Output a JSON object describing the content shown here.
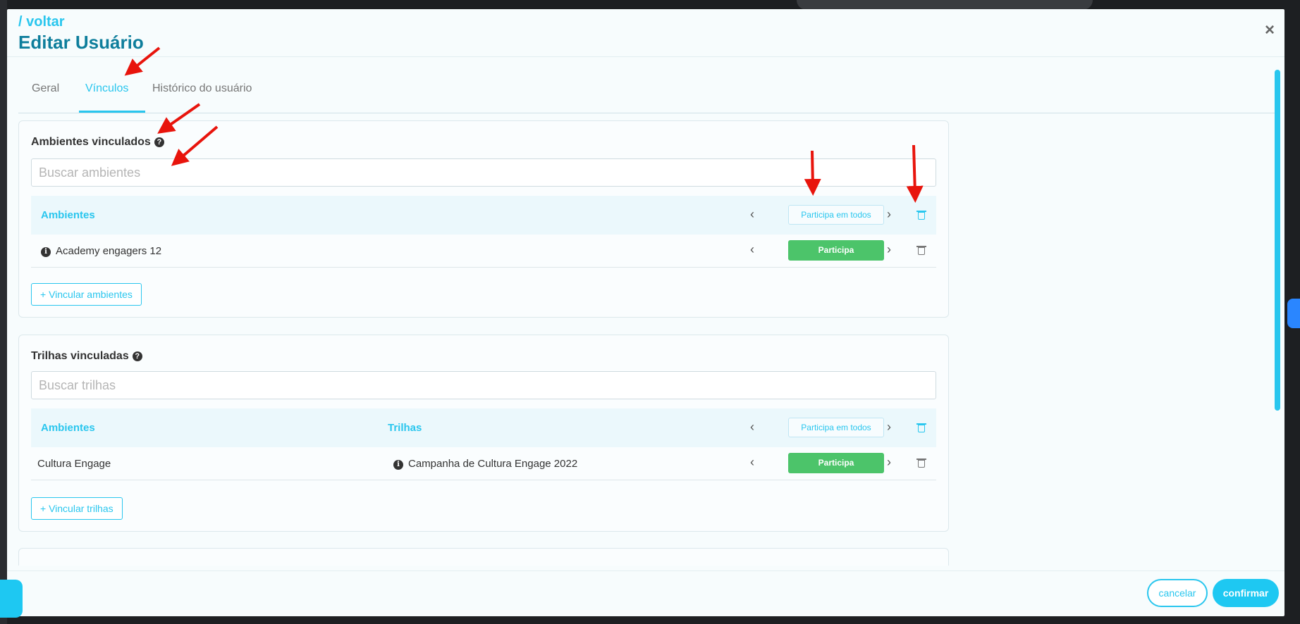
{
  "header": {
    "back_label": "/ voltar",
    "title": "Editar Usuário",
    "close_symbol": "×"
  },
  "tabs": [
    {
      "label": "Geral",
      "active": false
    },
    {
      "label": "Vínculos",
      "active": true
    },
    {
      "label": "Histórico do usuário",
      "active": false
    }
  ],
  "ambientes": {
    "title": "Ambientes vinculados",
    "search_placeholder": "Buscar ambientes",
    "col_ambientes": "Ambientes",
    "header_toggle": "Participa em todos",
    "rows": [
      {
        "name": "Academy engagers 12",
        "status": "Participa"
      }
    ],
    "add_button": "+ Vincular ambientes"
  },
  "trilhas": {
    "title": "Trilhas vinculadas",
    "search_placeholder": "Buscar trilhas",
    "col_ambientes": "Ambientes",
    "col_trilhas": "Trilhas",
    "header_toggle": "Participa em todos",
    "rows": [
      {
        "ambiente": "Cultura Engage",
        "trilha": "Campanha de Cultura Engage 2022",
        "status": "Participa"
      }
    ],
    "add_button": "+ Vincular trilhas"
  },
  "footer": {
    "cancel_label": "cancelar",
    "confirm_label": "confirmar"
  },
  "icons": {
    "help": "?",
    "info": "i",
    "prev": "‹",
    "next": "›"
  },
  "colors": {
    "accent": "#29c6ee",
    "title": "#0e7e9c",
    "success": "#4cc46a",
    "annotation": "#e8140c"
  }
}
